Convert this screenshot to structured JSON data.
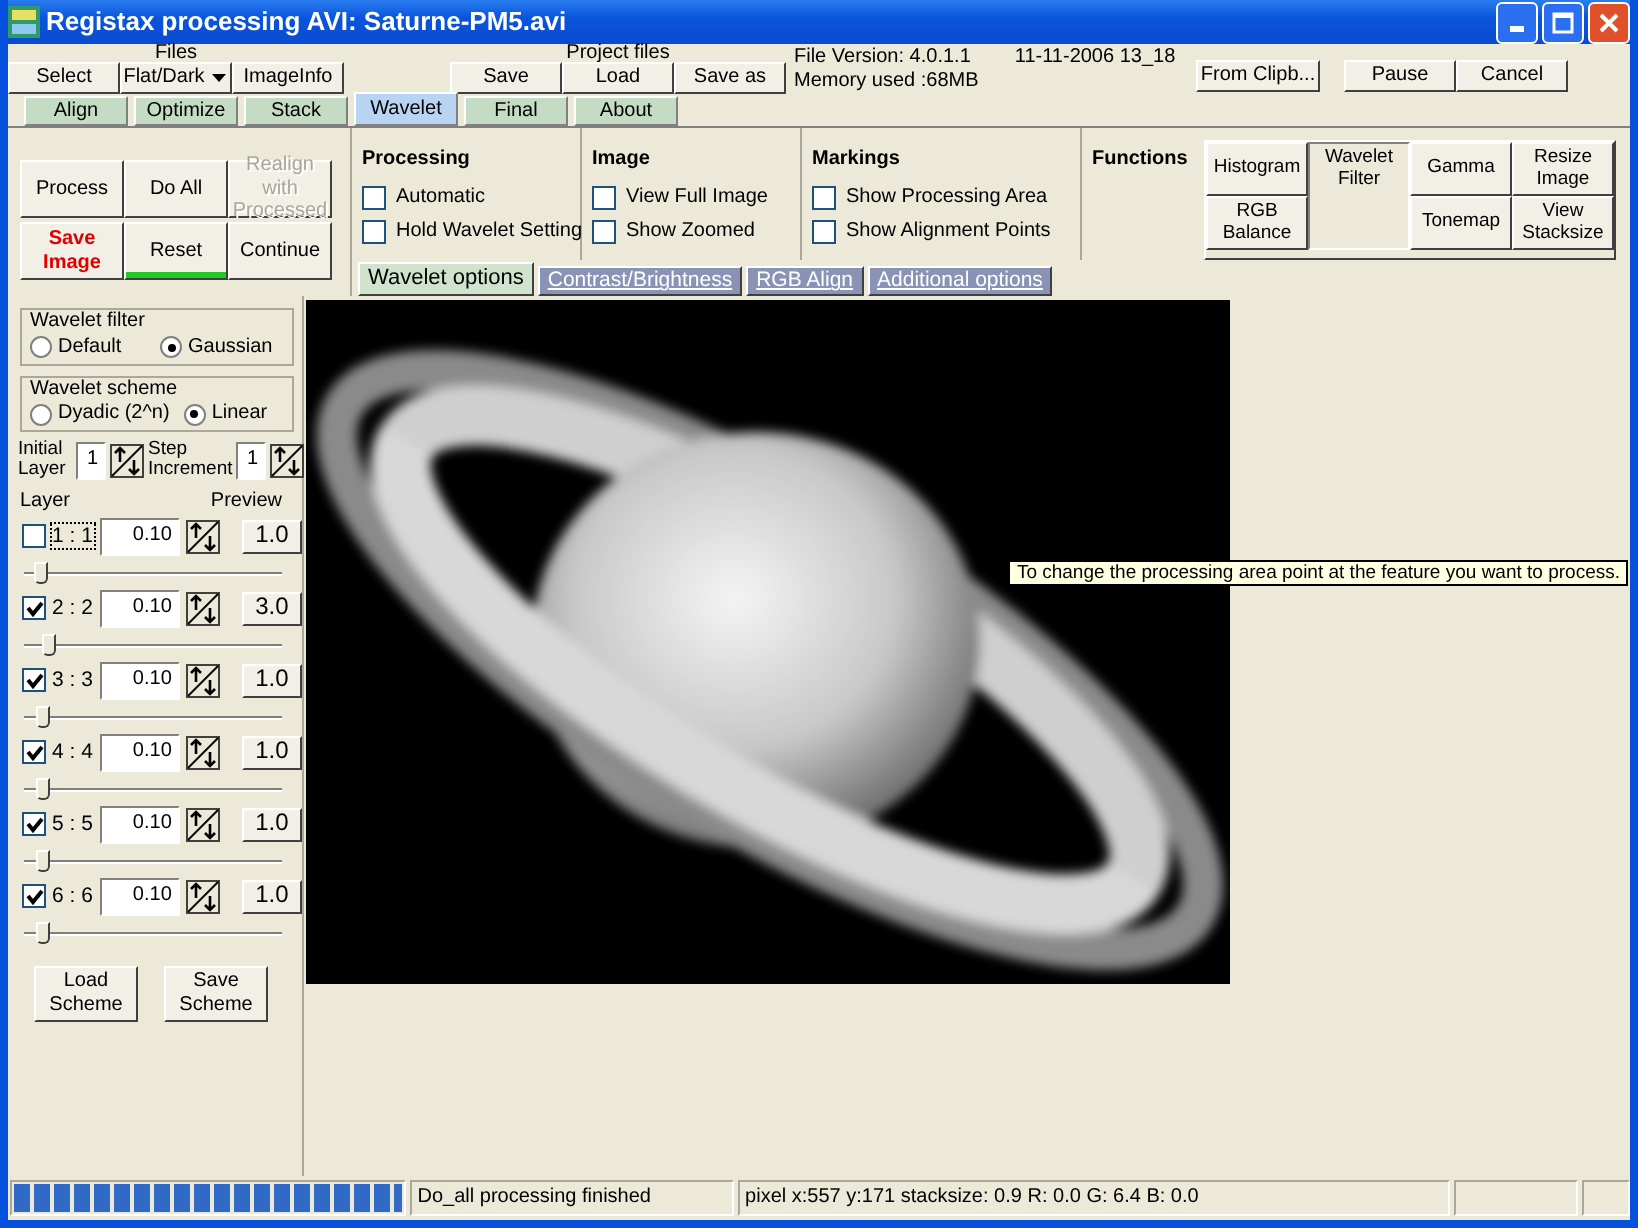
{
  "window": {
    "title": "Registax processing AVI: Saturne-PM5.avi"
  },
  "toolbar_groups": [
    {
      "label": "Files",
      "buttons": [
        {
          "label": "Select",
          "kind": "plain"
        },
        {
          "label": "Flat/Dark",
          "kind": "dropdown"
        },
        {
          "label": "ImageInfo",
          "kind": "plain"
        }
      ]
    },
    {
      "label": "Project files",
      "buttons": [
        {
          "label": "Save",
          "kind": "plain"
        },
        {
          "label": "Load",
          "kind": "plain"
        },
        {
          "label": "Save as",
          "kind": "plain"
        }
      ]
    }
  ],
  "file_info": {
    "version": "File Version: 4.0.1.1",
    "date": "11-11-2006 13_18",
    "memory": "Memory used :68MB"
  },
  "top_buttons": [
    "From Clipb...",
    "Pause",
    "Cancel"
  ],
  "tabs": [
    {
      "label": "Align",
      "selected": false
    },
    {
      "label": "Optimize",
      "selected": false
    },
    {
      "label": "Stack",
      "selected": false
    },
    {
      "label": "Wavelet",
      "selected": true
    },
    {
      "label": "Final",
      "selected": false
    },
    {
      "label": "About",
      "selected": false
    }
  ],
  "action_buttons": [
    {
      "label": "Process",
      "kind": "plain"
    },
    {
      "label": "Do All",
      "kind": "plain"
    },
    {
      "label": "Realign with Processed",
      "kind": "disabled"
    },
    {
      "label": "Save Image",
      "kind": "alert"
    },
    {
      "label": "Reset",
      "kind": "marked"
    },
    {
      "label": "Continue",
      "kind": "plain"
    }
  ],
  "option_groups": [
    {
      "title": "Processing",
      "checkboxes": [
        {
          "label": "Automatic",
          "checked": false
        },
        {
          "label": "Hold Wavelet Setting",
          "checked": false
        }
      ]
    },
    {
      "title": "Image",
      "checkboxes": [
        {
          "label": "View Full Image",
          "checked": false
        },
        {
          "label": "Show Zoomed",
          "checked": false
        }
      ]
    },
    {
      "title": "Markings",
      "checkboxes": [
        {
          "label": "Show Processing Area",
          "checked": false
        },
        {
          "label": "Show Alignment Points",
          "checked": false
        }
      ]
    }
  ],
  "functions": {
    "title": "Functions",
    "buttons": [
      {
        "label": "Histogram",
        "selected": false
      },
      {
        "label": "Wavelet Filter",
        "selected": true
      },
      {
        "label": "Gamma",
        "selected": false
      },
      {
        "label": "Resize Image",
        "selected": false
      },
      {
        "label": "RGB Balance",
        "selected": false
      },
      {
        "label": "Tonemap",
        "selected": false
      },
      {
        "label": "View Stacksize",
        "selected": false
      }
    ]
  },
  "subtabs": [
    {
      "label": "Wavelet options",
      "selected": true
    },
    {
      "label": "Contrast/Brightness",
      "selected": false
    },
    {
      "label": "RGB Align",
      "selected": false
    },
    {
      "label": "Additional options",
      "selected": false
    }
  ],
  "wavelet_filter": {
    "title": "Wavelet filter",
    "options": [
      {
        "label": "Default",
        "selected": false
      },
      {
        "label": "Gaussian",
        "selected": true
      }
    ]
  },
  "wavelet_scheme": {
    "title": "Wavelet scheme",
    "options": [
      {
        "label": "Dyadic (2^n)",
        "selected": false
      },
      {
        "label": "Linear",
        "selected": true
      }
    ]
  },
  "initial_layer": {
    "label": "Initial Layer",
    "value": "1"
  },
  "step_increment": {
    "label": "Step Increment",
    "value": "1"
  },
  "layer_header": {
    "layer": "Layer",
    "preview": "Preview"
  },
  "layers": [
    {
      "label": "1 : 1",
      "checked": false,
      "focused": true,
      "value": "0.10",
      "preview": "1.0",
      "level": 0.07
    },
    {
      "label": "2 : 2",
      "checked": true,
      "focused": false,
      "value": "0.10",
      "preview": "3.0",
      "level": 0.1
    },
    {
      "label": "3 : 3",
      "checked": true,
      "focused": false,
      "value": "0.10",
      "preview": "1.0",
      "level": 0.08
    },
    {
      "label": "4 : 4",
      "checked": true,
      "focused": false,
      "value": "0.10",
      "preview": "1.0",
      "level": 0.08
    },
    {
      "label": "5 : 5",
      "checked": true,
      "focused": false,
      "value": "0.10",
      "preview": "1.0",
      "level": 0.08
    },
    {
      "label": "6 : 6",
      "checked": true,
      "focused": false,
      "value": "0.10",
      "preview": "1.0",
      "level": 0.08
    }
  ],
  "scheme_buttons": [
    "Load Scheme",
    "Save Scheme"
  ],
  "tooltip": "To change the processing area point at the feature you want to process.",
  "status_bar": {
    "progress": {
      "level": 1
    },
    "message": "Do_all processing finished",
    "pixel_info": "pixel x:557 y:171 stacksize: 0.9 R: 0.0 G: 6.4 B: 0.0"
  }
}
